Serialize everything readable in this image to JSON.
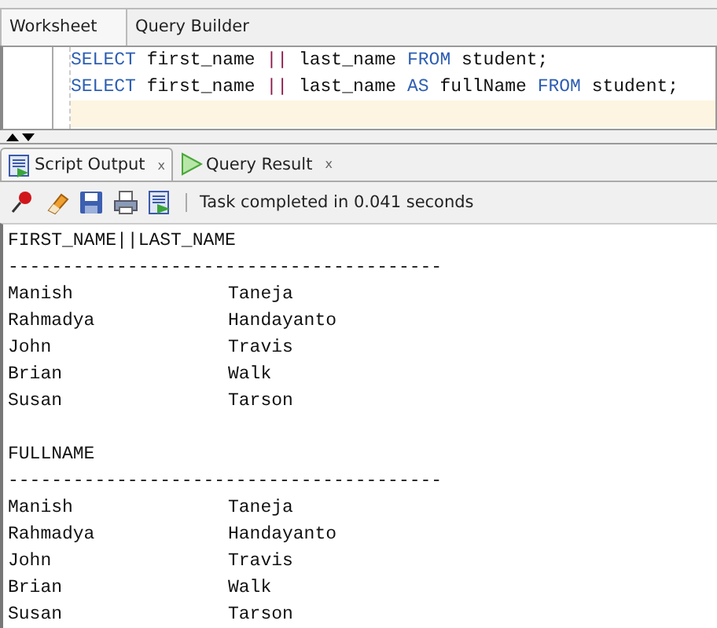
{
  "editor_tabs": [
    {
      "label": "Worksheet",
      "selected": true
    },
    {
      "label": "Query Builder",
      "selected": false
    }
  ],
  "editor": {
    "lines": [
      {
        "current": false,
        "tokens": [
          {
            "text": "SELECT",
            "kind": "keyword"
          },
          {
            "text": " first_name ",
            "kind": "plain"
          },
          {
            "text": "||",
            "kind": "operator"
          },
          {
            "text": " last_name ",
            "kind": "plain"
          },
          {
            "text": "FROM",
            "kind": "keyword"
          },
          {
            "text": " student;",
            "kind": "plain"
          }
        ]
      },
      {
        "current": false,
        "tokens": [
          {
            "text": "SELECT",
            "kind": "keyword"
          },
          {
            "text": " first_name ",
            "kind": "plain"
          },
          {
            "text": "||",
            "kind": "operator"
          },
          {
            "text": " last_name ",
            "kind": "plain"
          },
          {
            "text": "AS",
            "kind": "keyword"
          },
          {
            "text": " fullName ",
            "kind": "plain"
          },
          {
            "text": "FROM",
            "kind": "keyword"
          },
          {
            "text": " student;",
            "kind": "plain"
          }
        ]
      },
      {
        "current": true
      }
    ]
  },
  "output_tabs": [
    {
      "label": "Script Output",
      "close": "x",
      "selected": true,
      "kind": "script"
    },
    {
      "label": "Query Result",
      "close": "x",
      "selected": false,
      "kind": "query"
    }
  ],
  "status": "Task completed in 0.041 seconds",
  "results": [
    {
      "header": "FIRST_NAME||LAST_NAME",
      "rule": "----------------------------------------",
      "rows": [
        {
          "first": "Manish",
          "last": "Taneja"
        },
        {
          "first": "Rahmadya",
          "last": "Handayanto"
        },
        {
          "first": "John",
          "last": "Travis"
        },
        {
          "first": "Brian",
          "last": "Walk"
        },
        {
          "first": "Susan",
          "last": "Tarson"
        }
      ]
    },
    {
      "header": "FULLNAME",
      "rule": "----------------------------------------",
      "rows": [
        {
          "first": "Manish",
          "last": "Taneja"
        },
        {
          "first": "Rahmadya",
          "last": "Handayanto"
        },
        {
          "first": "John",
          "last": "Travis"
        },
        {
          "first": "Brian",
          "last": "Walk"
        },
        {
          "first": "Susan",
          "last": "Tarson"
        }
      ]
    }
  ]
}
